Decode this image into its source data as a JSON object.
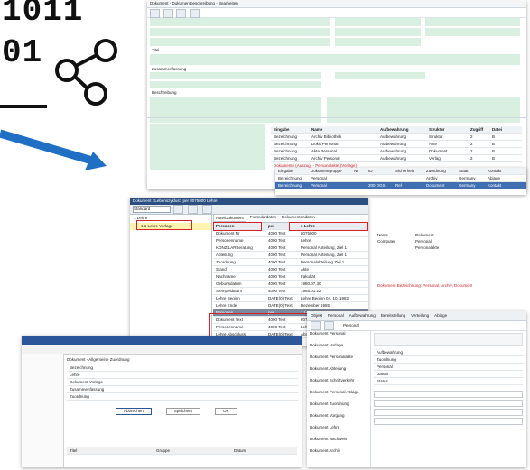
{
  "logo": {
    "binary_lines": [
      "1011",
      "01"
    ]
  },
  "main_form": {
    "title": "Dokument - Dokumentbeschreibung - Bearbeiten",
    "sections": [
      "Titel",
      "Zusammenfassung",
      "Beschreibung"
    ],
    "table_headers": [
      "Eingabe",
      "Name",
      "Aufbewahrung",
      "Struktur",
      "Zugriff",
      "Datei"
    ],
    "rows": [
      [
        "Bezeichnung",
        "Archiv Bibliothek",
        "Aufbewahrung",
        "Struktur",
        "2",
        "B"
      ],
      [
        "Bezeichnung",
        "Doku Personal",
        "Aufbewahrung",
        "Akte",
        "2",
        "B"
      ],
      [
        "Bezeichnung",
        "Akte Personal",
        "Aufbewahrung",
        "Dokument",
        "2",
        "B"
      ],
      [
        "Bezeichnung",
        "Archiv Personal",
        "Aufbewahrung",
        "Verlag",
        "2",
        "B"
      ]
    ],
    "highlight": "Dokumente (Auszug) - Personalakte (Vorlage)"
  },
  "lower_table": {
    "headers": [
      "Eingabe",
      "Dokumentgruppe",
      "Nr",
      "ID",
      "Sicherheit",
      "Zuordnung",
      "Staat",
      "Kontakt"
    ],
    "rows": [
      [
        "Bezeichnung",
        "Personal",
        "",
        "",
        "",
        "Archiv",
        "Germany",
        "Ablage"
      ],
      [
        "Bezeichnung",
        "Personal",
        "",
        "200 DGS",
        "Ref",
        "Dokument",
        "Germany",
        "Kontakt"
      ]
    ]
  },
  "right_panel": {
    "label_1": "Name",
    "label_2": "Computer",
    "value_1": "Dokument",
    "value_2": "Personal",
    "value_3": "Personalakte",
    "footer": "Dokument Bezeichnung: Personal, Archiv, Dokument"
  },
  "doc_window": {
    "title": "Dokument <Lebenszyklus> per 8075000 Lehre",
    "toolbar_select": "Standard",
    "tree_root": "1 Lehre",
    "tree_child": "1.1 Lehre Vorlage",
    "tabs": [
      "Akte/Dokument",
      "Formulardaten",
      "Dokumentendaten"
    ],
    "table_headers": [
      "Personen",
      "per",
      "1 Lehre"
    ],
    "rows": [
      [
        "Dokument Nr",
        "4000 Text",
        "8075000"
      ],
      [
        "Personenname",
        "4000 Text",
        "Lehre"
      ],
      [
        "KONZILARBeratung",
        "4000 Text",
        "Personal Abteilung, Ziel 1"
      ],
      [
        "Abteilung",
        "4000 Text",
        "Personal Abteilung, Ziel 1"
      ],
      [
        "Zuordnung",
        "4000 Text",
        "Personalabteilung Ziel 1"
      ],
      [
        "Stand",
        "4000 Text",
        "Akte"
      ],
      [
        "Nachname",
        "4000 Text",
        "Fakultät"
      ],
      [
        "Geburtsdatum",
        "4000 Text",
        "1980.07.30"
      ],
      [
        "Stempeldatum",
        "4000 Text",
        "1985.01.22"
      ],
      [
        "Lehre Beginn",
        "DATE(0) Text",
        "Lehre Beginn 04. 10. 1982"
      ],
      [
        "Lehre Ende",
        "DATE(0) Text",
        "Dezember 1985"
      ]
    ],
    "group_row": [
      "Personen",
      "per",
      "1 Lehre"
    ],
    "group_rows": [
      [
        "Dokument Text",
        "4000 Text",
        "8075000"
      ],
      [
        "Personenname",
        "4000 Text",
        "Lehre, Vorlage"
      ],
      [
        "Lehre Abschluss",
        "DATE(0) Text",
        "Abteilung Ziel 1"
      ]
    ]
  },
  "bottom_left": {
    "header": "Dokument - Allgemeine Zuordnung",
    "rows": [
      "Bezeichnung",
      "Lehre",
      "Dokument Vorlage",
      "Zusammenfassung",
      "Zuordnung"
    ],
    "buttons": [
      "Abbrechen",
      "Speichern",
      "OK"
    ],
    "table_headers": [
      "Titel",
      "Gruppe",
      "Datum"
    ]
  },
  "bottom_right": {
    "tabs": [
      "Objekt",
      "Personal",
      "Aufbewahrung",
      "Bereitstellung",
      "Verteilung",
      "Ablage"
    ],
    "list_items": [
      "Dokument Personal",
      "Dokument Vorlage",
      "Dokument Personalakte",
      "Dokument Abteilung",
      "Dokument Schriftverkehr",
      "Dokument Personal Ablage",
      "Dokument Zuordnung",
      "Dokument Vorgang",
      "Dokument Lehre",
      "Dokument Nachweis",
      "Dokument Archiv"
    ],
    "fields": [
      "Aufbewahrung",
      "Zuordnung",
      "Personal",
      "Datum",
      "Status"
    ],
    "selected_tab": "Personal"
  },
  "colors": {
    "accent_blue": "#1f6fc4",
    "highlight_red": "#d6232a",
    "green_field": "#d9efe2"
  }
}
